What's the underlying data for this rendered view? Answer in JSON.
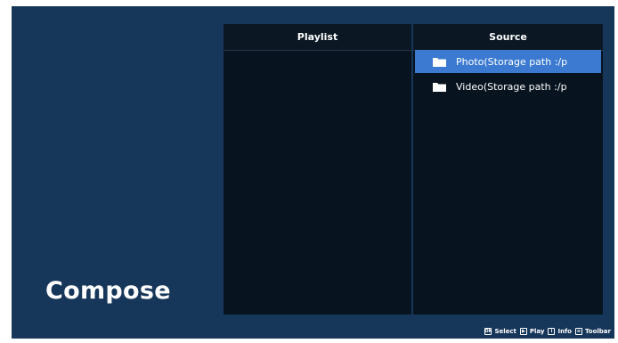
{
  "page": {
    "title": "Compose"
  },
  "playlist": {
    "header": "Playlist",
    "items": []
  },
  "source": {
    "header": "Source",
    "items": [
      {
        "label": "Photo(Storage path :/p",
        "icon": "folder-icon",
        "selected": true
      },
      {
        "label": "Video(Storage path :/p",
        "icon": "folder-icon",
        "selected": false
      }
    ]
  },
  "help_bar": {
    "items": [
      {
        "icon": "ok-key-icon",
        "glyph": "OK",
        "label": "Select"
      },
      {
        "icon": "play-key-icon",
        "glyph": "▶",
        "label": "Play"
      },
      {
        "icon": "info-key-icon",
        "glyph": "i",
        "label": "Info"
      },
      {
        "icon": "options-key-icon",
        "glyph": "≡",
        "label": "Toolbar"
      }
    ]
  },
  "colors": {
    "background": "#17375a",
    "panel": "#07141f",
    "selection": "#3b7ad0",
    "text": "#ffffff"
  }
}
